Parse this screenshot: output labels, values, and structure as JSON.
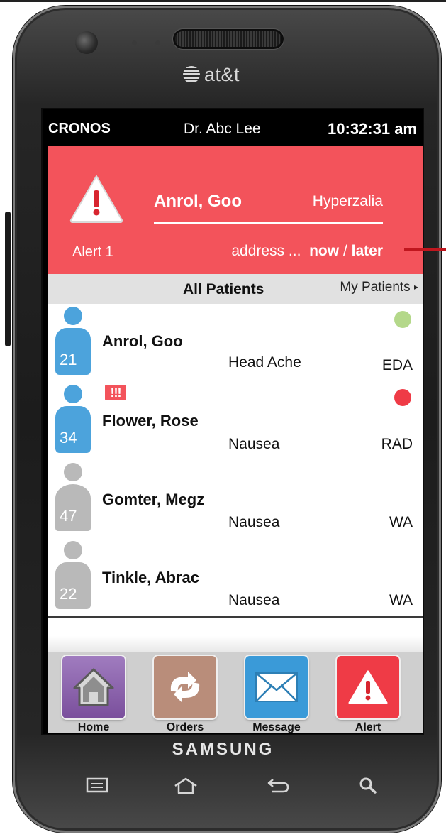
{
  "device": {
    "carrier": "at&t",
    "manufacturer": "SAMSUNG",
    "hardware_keys": [
      "menu-icon",
      "home-icon",
      "back-icon",
      "search-icon"
    ]
  },
  "status_bar": {
    "app_name": "CRONOS",
    "doctor": "Dr. Abc Lee",
    "time": "10:32:31 am"
  },
  "alert_banner": {
    "label": "Alert 1",
    "patient_name": "Anrol, Goo",
    "condition": "Hyperzalia",
    "address": "address",
    "ellipsis": "...",
    "now": "now",
    "separator": "/",
    "later": "later",
    "icon": "warning-triangle-icon",
    "color": "#f3535b"
  },
  "filter_bar": {
    "active": "All Patients",
    "other": "My Patients",
    "arrow": "▸"
  },
  "patients": [
    {
      "name": "Anrol, Goo",
      "number": "21",
      "diagnosis": "Head Ache",
      "dept": "EDA",
      "status_color": "#b4d88a",
      "avatar_color": "#4ca3dc",
      "flag": ""
    },
    {
      "name": "Flower, Rose",
      "number": "34",
      "diagnosis": "Nausea",
      "dept": "RAD",
      "status_color": "#ef3b46",
      "avatar_color": "#4ca3dc",
      "flag": "!!!"
    },
    {
      "name": "Gomter, Megz",
      "number": "47",
      "diagnosis": "Nausea",
      "dept": "WA",
      "status_color": "",
      "avatar_color": "#b9b9b9",
      "flag": ""
    },
    {
      "name": "Tinkle, Abrac",
      "number": "22",
      "diagnosis": "Nausea",
      "dept": "WA",
      "status_color": "",
      "avatar_color": "#b9b9b9",
      "flag": ""
    }
  ],
  "tab_bar": [
    {
      "label": "Home",
      "icon": "house-icon",
      "color": "#8a63a8"
    },
    {
      "label": "Orders",
      "icon": "refresh-arrows-icon",
      "color": "#b98d7a"
    },
    {
      "label": "Message",
      "icon": "envelope-icon",
      "color": "#3a9ad8"
    },
    {
      "label": "Alert",
      "icon": "warning-triangle-icon",
      "color": "#ef3b46"
    }
  ]
}
